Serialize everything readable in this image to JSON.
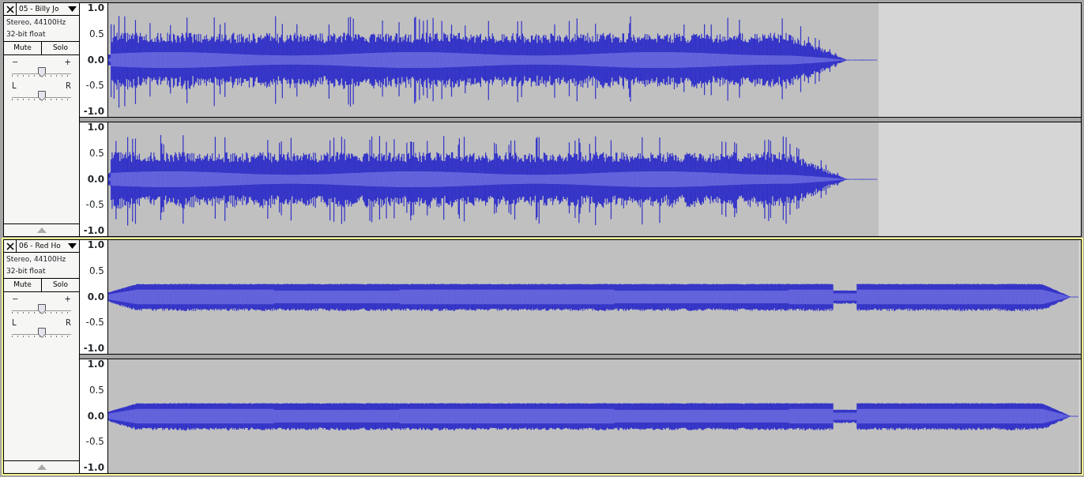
{
  "tracks": [
    {
      "name": "05 - Billy Jo",
      "selected": false,
      "kind": "dynamic",
      "format": [
        "Stereo, 44100Hz",
        "32-bit float"
      ],
      "buttons": [
        "Mute",
        "Solo"
      ],
      "gain": {
        "minus": "−",
        "plus": "+",
        "level": 0.5
      },
      "pan": {
        "left": "L",
        "right": "R",
        "level": 0.5
      },
      "channels": [
        {
          "ticks": [
            "1.0",
            "0.5",
            "0.0",
            "-0.5",
            "-1.0"
          ]
        },
        {
          "ticks": [
            "1.0",
            "0.5",
            "0.0",
            "-0.5",
            "-1.0"
          ]
        }
      ]
    },
    {
      "name": "06 - Red Ho",
      "selected": true,
      "kind": "limited",
      "format": [
        "Stereo, 44100Hz",
        "32-bit float"
      ],
      "buttons": [
        "Mute",
        "Solo"
      ],
      "gain": {
        "minus": "−",
        "plus": "+",
        "level": 0.5
      },
      "pan": {
        "left": "L",
        "right": "R",
        "level": 0.5
      },
      "channels": [
        {
          "ticks": [
            "1.0",
            "0.5",
            "0.0",
            "-0.5",
            "-1.0"
          ]
        },
        {
          "ticks": [
            "1.0",
            "0.5",
            "0.0",
            "-0.5",
            "-1.0"
          ]
        }
      ]
    }
  ]
}
